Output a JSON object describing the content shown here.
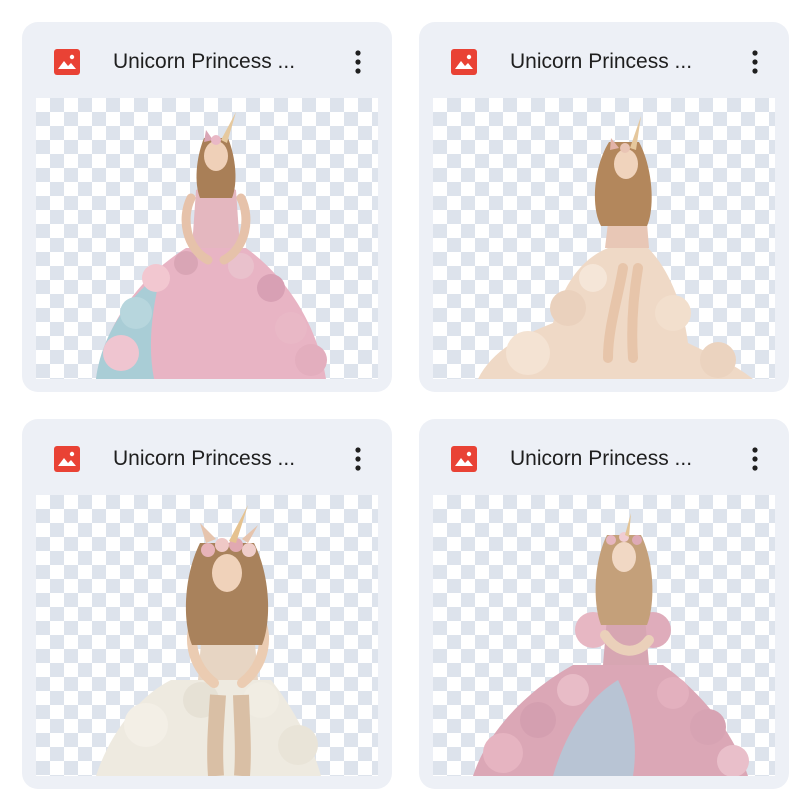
{
  "files": [
    {
      "name": "Unicorn Princess ...",
      "type_icon": "image-file-icon",
      "menu_icon": "more-vert-icon",
      "thumbnail": "unicorn-princess-pink-blue-gown"
    },
    {
      "name": "Unicorn Princess ...",
      "type_icon": "image-file-icon",
      "menu_icon": "more-vert-icon",
      "thumbnail": "unicorn-princess-cream-gown"
    },
    {
      "name": "Unicorn Princess ...",
      "type_icon": "image-file-icon",
      "menu_icon": "more-vert-icon",
      "thumbnail": "unicorn-princess-ivory-gown"
    },
    {
      "name": "Unicorn Princess ...",
      "type_icon": "image-file-icon",
      "menu_icon": "more-vert-icon",
      "thumbnail": "unicorn-princess-pastel-ruffle-gown"
    }
  ],
  "colors": {
    "card_background": "#edf0f6",
    "icon_red": "#e94235",
    "text": "#1f1f1f",
    "checker": "#dde3ec"
  }
}
